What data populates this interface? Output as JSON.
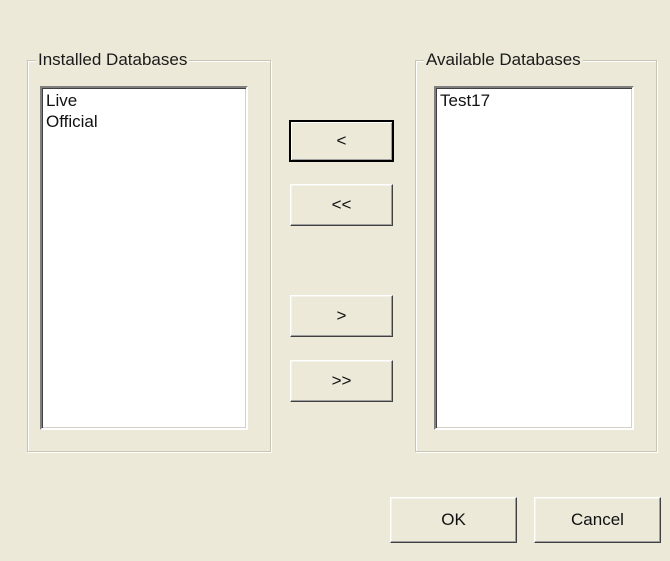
{
  "installed": {
    "label": "Installed Databases",
    "items": [
      "Live",
      "Official"
    ]
  },
  "available": {
    "label": "Available Databases",
    "items": [
      "Test17"
    ]
  },
  "transfer": {
    "add_one": "<",
    "add_all": "<<",
    "remove_one": ">",
    "remove_all": ">>"
  },
  "footer": {
    "ok": "OK",
    "cancel": "Cancel"
  }
}
